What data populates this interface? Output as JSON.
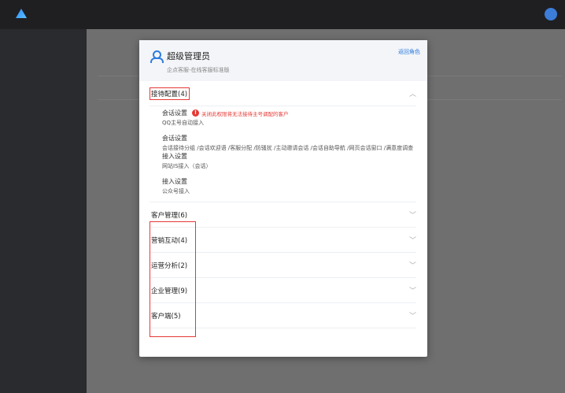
{
  "modal": {
    "role_name": "超级管理员",
    "role_desc": "企点客服-在线客服标准版",
    "back_link": "返回角色"
  },
  "expanded_section": {
    "label": "接待配置(4)",
    "blocks": [
      {
        "title": "会话设置",
        "warning": "关闭此权限将无法接待主号调配的客户",
        "text": "QQ主号自动接入"
      },
      {
        "title": "会话设置",
        "text": "会话接待分组 /会话欢迎语 /客服分配 /防骚扰 /主动邀请会话 /会话自助导航 /网页会话窗口 /满意度调查"
      },
      {
        "title": "接入设置",
        "text": "网站IS接入（会话）"
      },
      {
        "title": "接入设置",
        "text": "公众号接入"
      }
    ]
  },
  "collapsed_sections": [
    {
      "label": "客户管理(6)"
    },
    {
      "label": "营销互动(4)"
    },
    {
      "label": "运营分析(2)"
    },
    {
      "label": "企业管理(9)"
    },
    {
      "label": "客户端(5)"
    }
  ],
  "colors": {
    "accent": "#2f7bde",
    "warning": "#e53935",
    "highlight_box": "#e53935"
  },
  "icons": {
    "role": "user-icon",
    "expand": "chevron-up-icon",
    "collapse": "chevron-down-icon",
    "warning": "exclamation-circle-icon"
  }
}
